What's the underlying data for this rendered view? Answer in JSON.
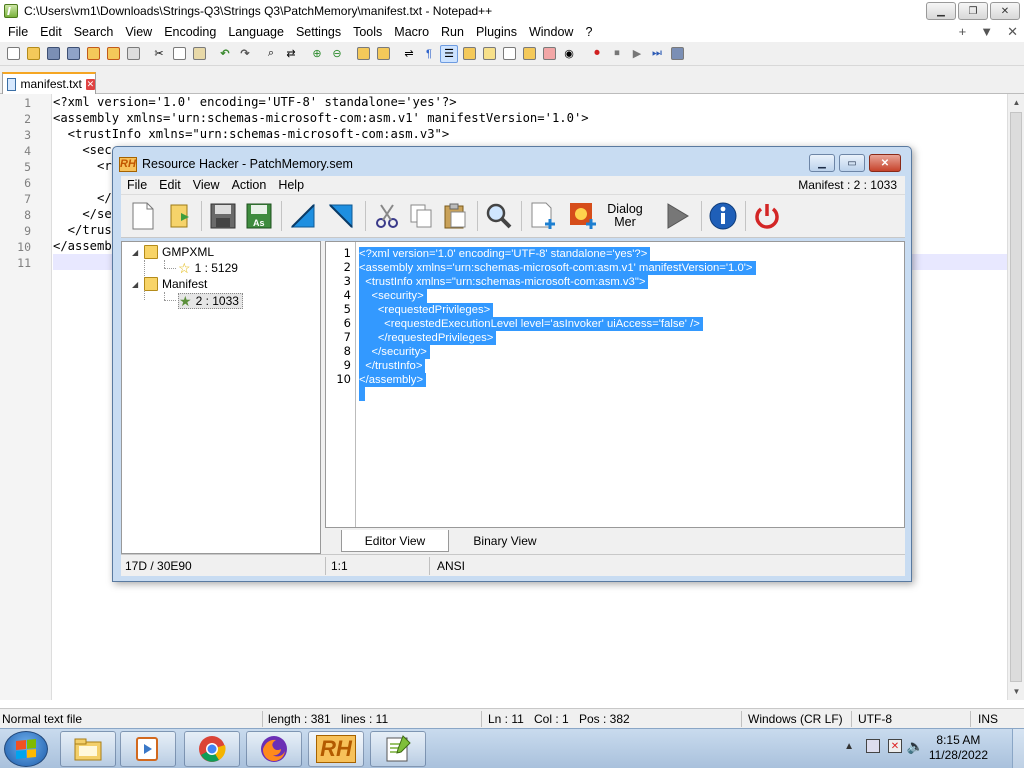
{
  "npp": {
    "title": "C:\\Users\\vm1\\Downloads\\Strings-Q3\\Strings Q3\\PatchMemory\\manifest.txt - Notepad++",
    "menu": [
      "File",
      "Edit",
      "Search",
      "View",
      "Encoding",
      "Language",
      "Settings",
      "Tools",
      "Macro",
      "Run",
      "Plugins",
      "Window",
      "?"
    ],
    "menu_right": [
      "+",
      "▼",
      "✕"
    ],
    "tab": "manifest.txt",
    "line_numbers": [
      "1",
      "2",
      "3",
      "4",
      "5",
      "6",
      "7",
      "8",
      "9",
      "10",
      "11"
    ],
    "code_lines": [
      "<?xml version='1.0' encoding='UTF-8' standalone='yes'?>",
      "<assembly xmlns='urn:schemas-microsoft-com:asm.v1' manifestVersion='1.0'>",
      "  <trustInfo xmlns=\"urn:schemas-microsoft-com:asm.v3\">",
      "    <sec",
      "      <r",
      "",
      "      </",
      "    </se",
      "  </trus",
      "</assemb",
      ""
    ],
    "status": {
      "type": "Normal text file",
      "length": "length : 381",
      "lines": "lines : 11",
      "ln": "Ln : 11",
      "col": "Col : 1",
      "pos": "Pos : 382",
      "eol": "Windows (CR LF)",
      "encoding": "UTF-8",
      "mode": "INS"
    }
  },
  "rh": {
    "title": "Resource Hacker - PatchMemory.sem",
    "logo": "RH",
    "menu": [
      "File",
      "Edit",
      "View",
      "Action",
      "Help"
    ],
    "resource_info": "Manifest : 2 : 1033",
    "toolbar_dialog_label": "Dialog",
    "toolbar_menu_label": "Mer",
    "tree": {
      "gmpxml": "GMPXML",
      "gmpxml_item": "1 : 5129",
      "manifest": "Manifest",
      "manifest_item": "2 : 1033"
    },
    "line_numbers": [
      "1",
      "2",
      "3",
      "4",
      "5",
      "6",
      "7",
      "8",
      "9",
      "10"
    ],
    "code_lines": [
      "<?xml version='1.0' encoding='UTF-8' standalone='yes'?>",
      "<assembly xmlns='urn:schemas-microsoft-com:asm.v1' manifestVersion='1.0'>",
      "  <trustInfo xmlns=\"urn:schemas-microsoft-com:asm.v3\">",
      "    <security>",
      "      <requestedPrivileges>",
      "        <requestedExecutionLevel level='asInvoker' uiAccess='false' />",
      "      </requestedPrivileges>",
      "    </security>",
      "  </trustInfo>",
      "</assembly>",
      " "
    ],
    "tabs": {
      "editor": "Editor View",
      "binary": "Binary View"
    },
    "status": {
      "offset": "17D / 30E90",
      "position": "1:1",
      "encoding": "ANSI"
    }
  },
  "taskbar": {
    "time": "8:15 AM",
    "date": "11/28/2022",
    "rh_label": "RH"
  },
  "colors": {
    "selection": "#3399ff",
    "tab_accent": "#f5a623",
    "rh_frame": "#c8dcf2"
  }
}
